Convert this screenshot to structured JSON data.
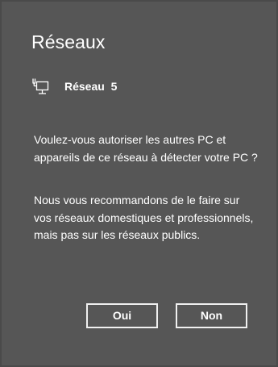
{
  "dialog": {
    "title": "Réseaux",
    "network": {
      "icon": "wired-network-icon",
      "name": "Réseau  5"
    },
    "message_paragraphs": [
      "Voulez-vous autoriser les autres PC et appareils de ce réseau à détecter votre PC ?",
      "Nous vous recommandons de le faire sur vos réseaux domestiques et professionnels, mais pas sur les réseaux publics."
    ],
    "buttons": {
      "yes_label": "Oui",
      "no_label": "Non"
    }
  },
  "colors": {
    "background": "#565656",
    "text": "#ffffff",
    "button_border": "#f0f0f0"
  }
}
